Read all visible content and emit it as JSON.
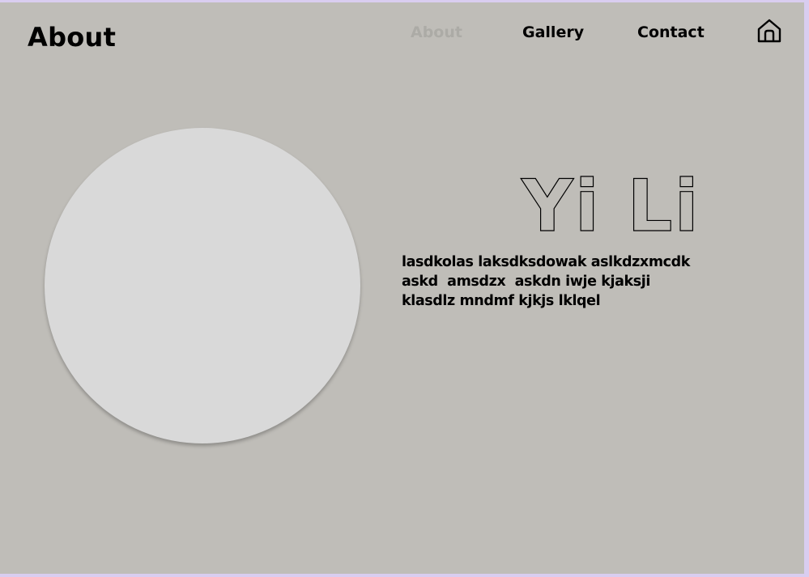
{
  "page": {
    "title": "About"
  },
  "nav": {
    "items": [
      {
        "label": "About",
        "active": true
      },
      {
        "label": "Gallery",
        "active": false
      },
      {
        "label": "Contact",
        "active": false
      }
    ],
    "home_icon": "home-icon"
  },
  "profile": {
    "name": "Yi Li",
    "bio": "lasdkolas laksdksdowak aslkdzxmcdk\naskd  amsdzx  askdn iwje kjaksji\nklasdlz mndmf kjkjs lklqel"
  },
  "colors": {
    "page_background": "#bfbdb8",
    "outer_border": "#d9cdf0",
    "photo_placeholder": "#d9d9d9",
    "active_nav": "#acaba6",
    "text": "#000000"
  }
}
